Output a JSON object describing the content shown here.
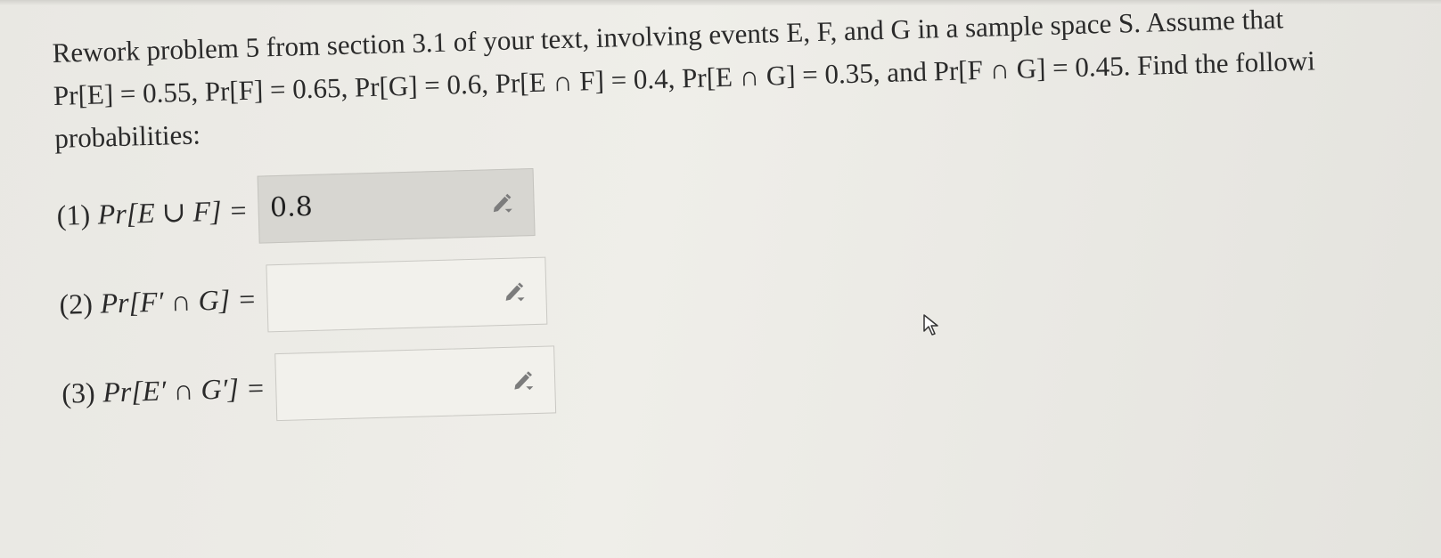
{
  "prompt": {
    "line1": "Rework problem 5 from section 3.1 of your text, involving events E, F, and G in a sample space S. Assume that",
    "line2": "Pr[E] = 0.55, Pr[F] = 0.65, Pr[G] = 0.6, Pr[E ∩ F] = 0.4, Pr[E ∩ G] = 0.35, and Pr[F ∩ G] = 0.45. Find the followi",
    "line3": "probabilities:"
  },
  "questions": [
    {
      "number": "(1)",
      "label": "Pr[E ∪ F] =",
      "value": "0.8"
    },
    {
      "number": "(2)",
      "label": "Pr[F′ ∩ G] =",
      "value": ""
    },
    {
      "number": "(3)",
      "label": "Pr[E′ ∩ G′] =",
      "value": ""
    }
  ],
  "icons": {
    "edit": "pencil-dropdown-icon",
    "cursor": "mouse-pointer-icon"
  },
  "colors": {
    "page_bg": "#ebeae5",
    "filled_box_bg": "#d7d6d1",
    "empty_box_bg": "#f2f1ec",
    "text": "#2a2a2a"
  }
}
